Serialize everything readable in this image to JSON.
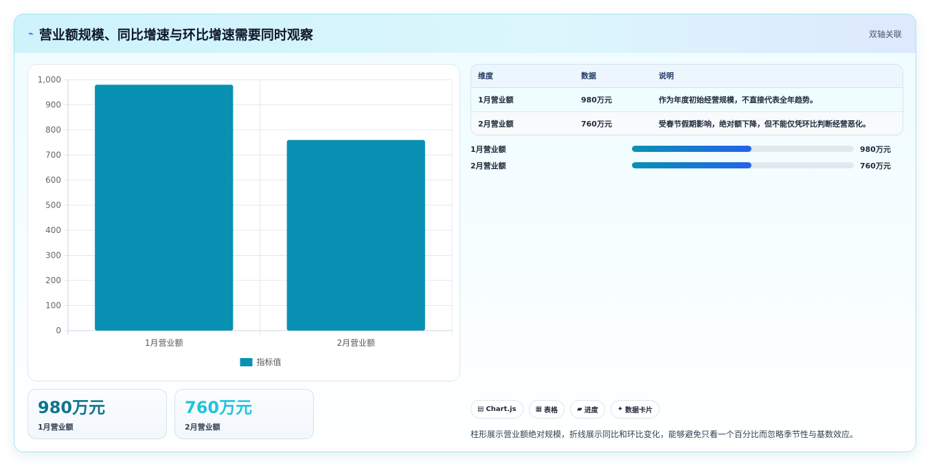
{
  "header": {
    "title": "营业额规模、同比增速与环比增速需要同时观察",
    "tag": "双轴关联",
    "icon": "trend-icon"
  },
  "table": {
    "columns": [
      "维度",
      "数据",
      "说明"
    ],
    "rows": [
      [
        "1月营业额",
        "980万元",
        "作为年度初始经营规模，不直接代表全年趋势。"
      ],
      [
        "2月营业额",
        "760万元",
        "受春节假期影响，绝对额下降，但不能仅凭环比判断经营恶化。"
      ]
    ]
  },
  "progress": [
    {
      "label": "1月营业额",
      "value": "980万元",
      "fill": 0.54
    },
    {
      "label": "2月营业额",
      "value": "760万元",
      "fill": 0.54
    }
  ],
  "kpis": [
    {
      "value": "980万元",
      "label": "1月营业额",
      "color": "#0e7490"
    },
    {
      "value": "760万元",
      "label": "2月营业额",
      "color": "#22c3dd"
    }
  ],
  "chips": [
    {
      "icon": "▤",
      "label": "Chart.js"
    },
    {
      "icon": "▦",
      "label": "表格"
    },
    {
      "icon": "▰",
      "label": "进度"
    },
    {
      "icon": "✦",
      "label": "数据卡片"
    }
  ],
  "note": "柱形展示营业额绝对规模，折线展示同比和环比变化，能够避免只看一个百分比而忽略季节性与基数效应。",
  "chart_data": {
    "type": "bar",
    "categories": [
      "1月营业额",
      "2月营业额"
    ],
    "series": [
      {
        "name": "指标值",
        "values": [
          980,
          760
        ],
        "color": "#0891b2"
      }
    ],
    "ylim": [
      0,
      1000
    ],
    "yticks": [
      0,
      100,
      200,
      300,
      400,
      500,
      600,
      700,
      800,
      900,
      1000
    ],
    "ytick_labels": [
      "0",
      "100",
      "200",
      "300",
      "400",
      "500",
      "600",
      "700",
      "800",
      "900",
      "1,000"
    ],
    "grid": true,
    "legend": "bottom"
  }
}
